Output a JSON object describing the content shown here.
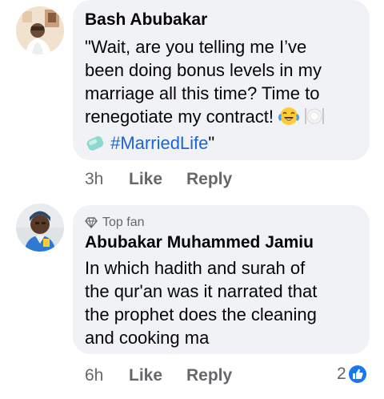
{
  "comments": [
    {
      "author": "Bash Abubakar",
      "text_lines": [
        "\"Wait, are you telling me I’ve",
        "been doing bonus levels in my",
        "marriage all this time? Time to",
        "renegotiate my contract!"
      ],
      "hashtag": "#MarriedLife",
      "closing_quote": "\"",
      "emojis": [
        "laughing-crying-emoji",
        "plate-cutlery-emoji",
        "soap-emoji"
      ],
      "time": "3h",
      "like_label": "Like",
      "reply_label": "Reply"
    },
    {
      "badge": "Top fan",
      "author": "Abubakar Muhammed Jamiu",
      "text_lines": [
        "In which hadith and surah of",
        "the qur'an was it narrated that",
        "the prophet does the cleaning",
        "and cooking ma"
      ],
      "time": "6h",
      "like_label": "Like",
      "reply_label": "Reply",
      "reaction_count": "2",
      "reaction_type": "like-reaction-icon"
    }
  ],
  "colors": {
    "bubble": "#f0f2f5",
    "meta": "#65676b",
    "hashtag": "#1b65d6",
    "like_blue": "#1877f2"
  }
}
